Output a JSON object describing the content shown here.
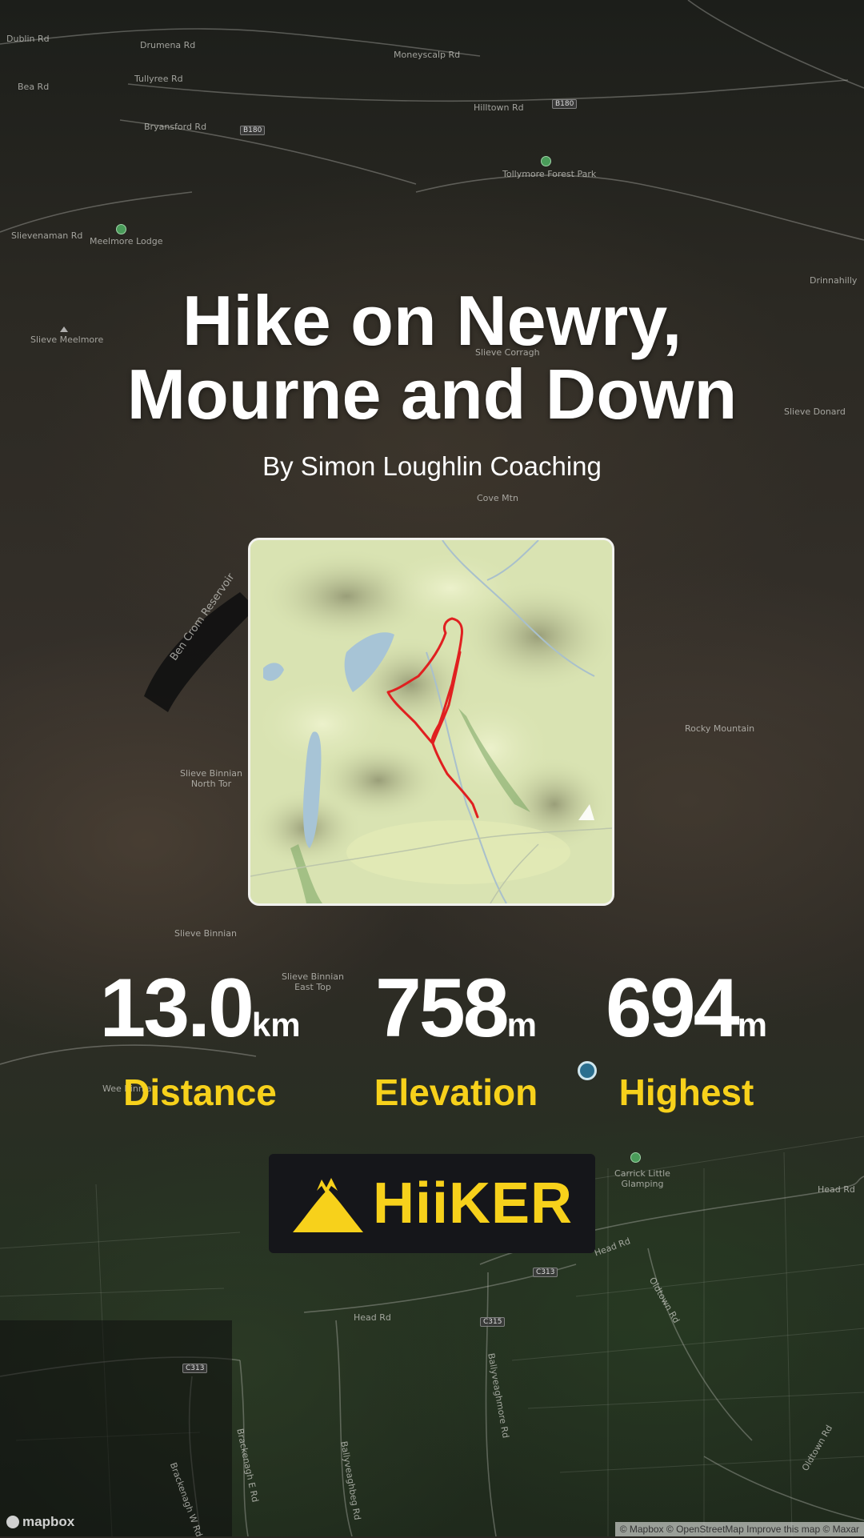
{
  "map": {
    "labels": {
      "dublin_rd": "Dublin Rd",
      "drumena_rd": "Drumena Rd",
      "moneyscalp_rd": "Moneyscalp Rd",
      "tullyree_rd": "Tullyree Rd",
      "bea_rd": "Bea Rd",
      "hilltown_rd": "Hilltown Rd",
      "bryansford_rd": "Bryansford Rd",
      "tollymore": "Tollymore Forest Park",
      "slievenaman_rd": "Slievenaman Rd",
      "meelmore_lodge": "Meelmore Lodge",
      "drinnahilly": "Drinnahilly",
      "slieve_meelmore": "Slieve Meelmore",
      "slieve_corragh": "Slieve Corragh",
      "slieve_donard": "Slieve Donard",
      "cove_mtn": "Cove Mtn",
      "ben_crom": "Ben Crom Reservoir",
      "rocky_mountain": "Rocky Mountain",
      "slieve_binnian_north_tor": "Slieve Binnian North Tor",
      "slieve_binnian": "Slieve Binnian",
      "slieve_binnian_east_top": "Slieve Binnian East Top",
      "wee_binnian": "Wee Binnian",
      "carrick_little": "Carrick Little Glamping",
      "head_rd_1": "Head Rd",
      "head_rd_2": "Head Rd",
      "head_rd_3": "Head Rd",
      "oldtown_rd": "Oldtown Rd",
      "ballyveaghmore_rd": "Ballyveaghmore Rd",
      "ballyveaghbeg_rd": "Ballyveaghbeg Rd",
      "brackenagh_e_rd": "Brackenagh E Rd",
      "brackenagh_w_rd": "Brackenagh W Rd",
      "oldtown_rd_2": "Oldtown Rd"
    },
    "shields": {
      "b180_a": "B180",
      "b180_b": "B180",
      "c313_a": "C313",
      "c313_b": "C313",
      "c315": "C315"
    },
    "mapbox_logo": "mapbox",
    "attribution": "© Mapbox © OpenStreetMap  Improve this map  © Maxar"
  },
  "hike": {
    "title_line1": "Hike on Newry,",
    "title_line2": "Mourne and Down",
    "author": "By Simon Loughlin Coaching"
  },
  "stats": {
    "distance": {
      "value": "13.0",
      "unit": "km",
      "label": "Distance"
    },
    "elevation": {
      "value": "758",
      "unit": "m",
      "label": "Elevation"
    },
    "highest": {
      "value": "694",
      "unit": "m",
      "label": "Highest"
    }
  },
  "brand": {
    "name": "HiiKER",
    "color": "#f7d11b"
  },
  "route": {
    "color": "#e02020"
  }
}
